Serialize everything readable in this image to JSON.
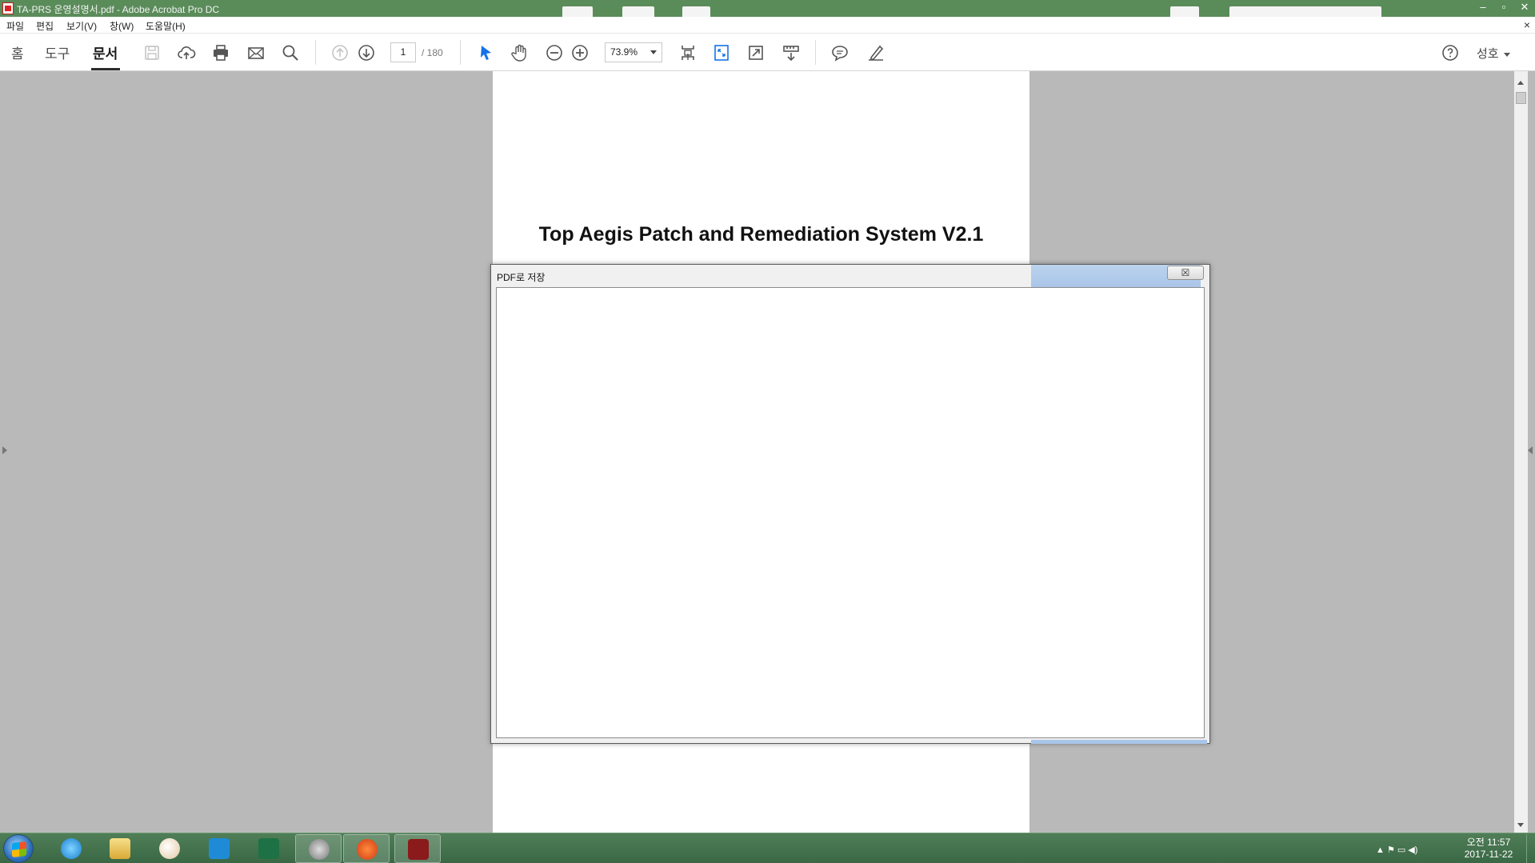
{
  "window": {
    "title": "TA-PRS 운영설명서.pdf - Adobe Acrobat Pro DC",
    "controls": [
      "–",
      "▫",
      "✕"
    ]
  },
  "menu": {
    "items": [
      "파일",
      "편집",
      "보기(V)",
      "창(W)",
      "도움말(H)"
    ],
    "close_doc": "×"
  },
  "toolbar": {
    "tabs": [
      "홈",
      "도구",
      "문서"
    ],
    "active_tab": "문서",
    "page_current": "1",
    "page_total": "/ 180",
    "zoom": "73.9%",
    "user": "성호",
    "icons": [
      "save-icon",
      "cloud-upload-icon",
      "print-icon",
      "mail-icon",
      "search-icon",
      "page-up-icon",
      "page-down-icon",
      "select-cursor-icon",
      "hand-icon",
      "zoom-out-icon",
      "zoom-in-icon",
      "scroll-mode-icon",
      "fit-page-icon",
      "fullscreen-icon",
      "read-mode-icon",
      "comment-icon",
      "sign-icon",
      "help-icon"
    ],
    "accent_color": "#1473e6"
  },
  "document": {
    "title": "Top Aegis Patch and Remediation System V2.1"
  },
  "dialog": {
    "title": "PDF로 저장",
    "close_symbol": "☒"
  },
  "taskbar": {
    "apps": [
      "internet-explorer-icon",
      "file-explorer-icon",
      "paint-icon",
      "outlook-icon",
      "excel-icon",
      "tool-icon",
      "mail-at-icon",
      "acrobat-icon"
    ],
    "active_app": "acrobat-icon",
    "tray": "▲ ⚑ ▭ ◀)",
    "time": "오전 11:57",
    "date": "2017-11-22"
  }
}
